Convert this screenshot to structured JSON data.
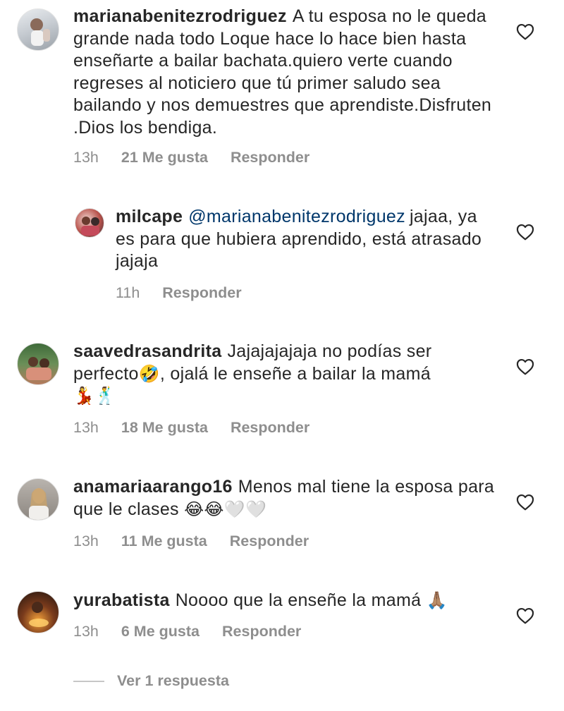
{
  "comments": [
    {
      "username": "marianabenitezrodriguez",
      "text": "A tu esposa no le queda grande nada todo Loque hace lo hace bien hasta enseñarte a bailar bachata.quiero verte cuando regreses al noticiero que tú primer saludo sea bailando y nos demuestres que aprendiste.Disfruten .Dios los bendiga.",
      "time": "13h",
      "likes": "21 Me gusta",
      "reply_label": "Responder"
    },
    {
      "username": "milcape",
      "mention": "@marianabenitezrodriguez",
      "text": "jajaa, ya es para que hubiera aprendido, está atrasado jajaja",
      "time": "11h",
      "reply_label": "Responder"
    },
    {
      "username": "saavedrasandrita",
      "text": "Jajajajajaja no podías ser perfecto",
      "text_emoji": "🤣",
      "text_after": ", ojalá le enseñe a bailar la mamá",
      "trailing_emoji": "💃🕺",
      "time": "13h",
      "likes": "18 Me gusta",
      "reply_label": "Responder"
    },
    {
      "username": "anamariaarango16",
      "text": "Menos mal tiene la esposa para que le clases",
      "trailing_emoji": "😂😂🤍🤍",
      "time": "13h",
      "likes": "11 Me gusta",
      "reply_label": "Responder"
    },
    {
      "username": "yurabatista",
      "text": "Noooo que la enseñe la mamá",
      "trailing_emoji": "🙏🏽",
      "time": "13h",
      "likes": "6 Me gusta",
      "reply_label": "Responder"
    }
  ],
  "view_replies": "Ver 1 respuesta",
  "icons": {
    "like": "heart-outline-icon"
  },
  "colors": {
    "text": "#262626",
    "meta": "#8e8e8e",
    "mention": "#00376b"
  }
}
